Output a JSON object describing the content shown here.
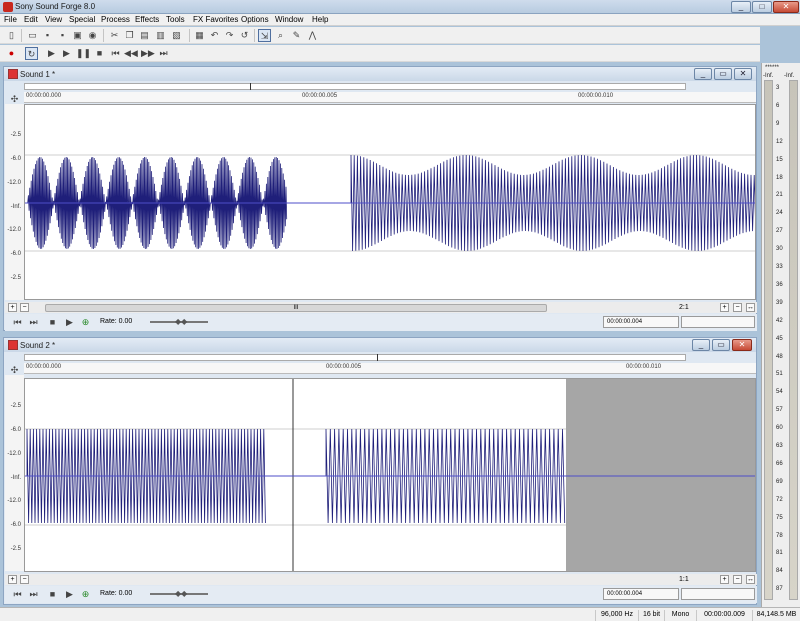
{
  "app": {
    "title": "Sony Sound Forge 8.0",
    "brand_color": "#c8281e"
  },
  "window_controls": {
    "minimize": "_",
    "maximize": "□",
    "close": "✕"
  },
  "menu": [
    "File",
    "Edit",
    "View",
    "Special",
    "Process",
    "Effects",
    "Tools",
    "FX Favorites",
    "Options",
    "Window",
    "Help"
  ],
  "toolbar1_icons": [
    "new-icon",
    "open-icon",
    "save-icon",
    "save-as-icon",
    "render-icon",
    "cd-icon",
    "cut-icon",
    "copy-icon",
    "paste-icon",
    "mix-icon",
    "crop-icon",
    "undo-icon",
    "redo-icon",
    "repeat-icon",
    "edit-tool-icon",
    "magnify-tool-icon",
    "pencil-tool-icon",
    "envelope-tool-icon"
  ],
  "toolbar2_icons": [
    "record-icon",
    "loop-icon",
    "play-all-icon",
    "play-icon",
    "pause-icon",
    "stop-icon",
    "go-start-icon",
    "rewind-icon",
    "forward-icon",
    "go-end-icon"
  ],
  "sound1": {
    "title": "Sound 1 *",
    "ruler": [
      "00:00:00.000",
      "00:00:00.005",
      "00:00:00.010"
    ],
    "db": [
      "-2.5",
      "-6.0",
      "-12.0",
      "-Inf.",
      "-12.0",
      "-6.0",
      "-2.5"
    ],
    "zoom": "2:1",
    "rate": "Rate: 0.00",
    "time": "00:00:00.004",
    "scroll_mark": "III"
  },
  "sound2": {
    "title": "Sound 2 *",
    "ruler": [
      "00:00:00.000",
      "00:00:00.005",
      "00:00:00.010"
    ],
    "db": [
      "-2.5",
      "-6.0",
      "-12.0",
      "-Inf.",
      "-12.0",
      "-6.0",
      "-2.5"
    ],
    "zoom": "1:1",
    "rate": "Rate: 0.00",
    "time": "00:00:00.004"
  },
  "meter": {
    "header": "******",
    "left": "-Inf.",
    "right": "-Inf.",
    "scale": [
      "3",
      "6",
      "9",
      "12",
      "15",
      "18",
      "21",
      "24",
      "27",
      "30",
      "33",
      "36",
      "39",
      "42",
      "45",
      "48",
      "51",
      "54",
      "57",
      "60",
      "63",
      "66",
      "69",
      "72",
      "75",
      "78",
      "81",
      "84",
      "87"
    ]
  },
  "status": {
    "sample_rate": "96,000 Hz",
    "bit_depth": "16 bit",
    "channels": "Mono",
    "length": "00:00:00.009",
    "free_space": "84,148.5 MB"
  },
  "colors": {
    "waveform": "#1f1f7a",
    "selection": "#a6a6a6",
    "center_line": "#4d4dc8"
  }
}
